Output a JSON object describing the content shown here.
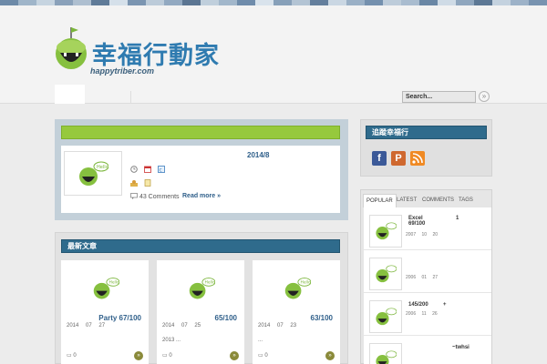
{
  "theme": {
    "mosaic_colors": [
      "#6d8aa8",
      "#9fb5c9",
      "#c6d4e0",
      "#8aa1ba",
      "#aebfd0",
      "#5f7b98",
      "#d5e0ea",
      "#7b95b1",
      "#bccbd9",
      "#92a9c1",
      "#5b7592",
      "#c0cfdc",
      "#a2b7cb",
      "#6f8cab",
      "#d9e3ec",
      "#87a0b9",
      "#b3c4d4",
      "#647f9d",
      "#cad7e3",
      "#9ab0c6",
      "#7490ae",
      "#bdccda",
      "#a9bccf",
      "#6a87a5",
      "#cfdbe6",
      "#8fa6be",
      "#5d7895",
      "#c4d2df",
      "#9db2c8",
      "#7893b0"
    ],
    "accent_green": "#96c93d",
    "accent_blue": "#2f6b8c"
  },
  "header": {
    "site_title": "幸福行動家",
    "site_url": "happytriber.com",
    "search_placeholder": "Search...",
    "search_button_icon": "chevron-right-circle-icon"
  },
  "featured_post": {
    "date": "2014/8",
    "comments": "43 Comments",
    "read_more": "Read more »"
  },
  "grid_section": {
    "title": "最新文章",
    "cards": [
      {
        "title": "Party 67/100",
        "date": "2014 07 27",
        "excerpt": "",
        "comments": "0"
      },
      {
        "title": "65/100",
        "date": "2014 07 25",
        "excerpt": "2013 ...",
        "comments": "0"
      },
      {
        "title": "63/100",
        "date": "2014 07 23",
        "excerpt": "...",
        "comments": "0"
      }
    ]
  },
  "sidebar": {
    "social_title": "追蹤幸福行",
    "social_icons": [
      "facebook-icon",
      "plurk-icon",
      "rss-icon"
    ],
    "tabs": [
      "POPULAR",
      "LATEST",
      "COMMENTS",
      "TAGS"
    ],
    "popular": [
      {
        "title": "Excel 69/100",
        "num": "1",
        "date": "2007 10 20"
      },
      {
        "title": "",
        "num": "",
        "date": "2006 01 27"
      },
      {
        "title": "145/200",
        "num": "+",
        "date": "2006 11 26"
      },
      {
        "title": "~twhsi",
        "num": "",
        "date": ""
      }
    ]
  }
}
